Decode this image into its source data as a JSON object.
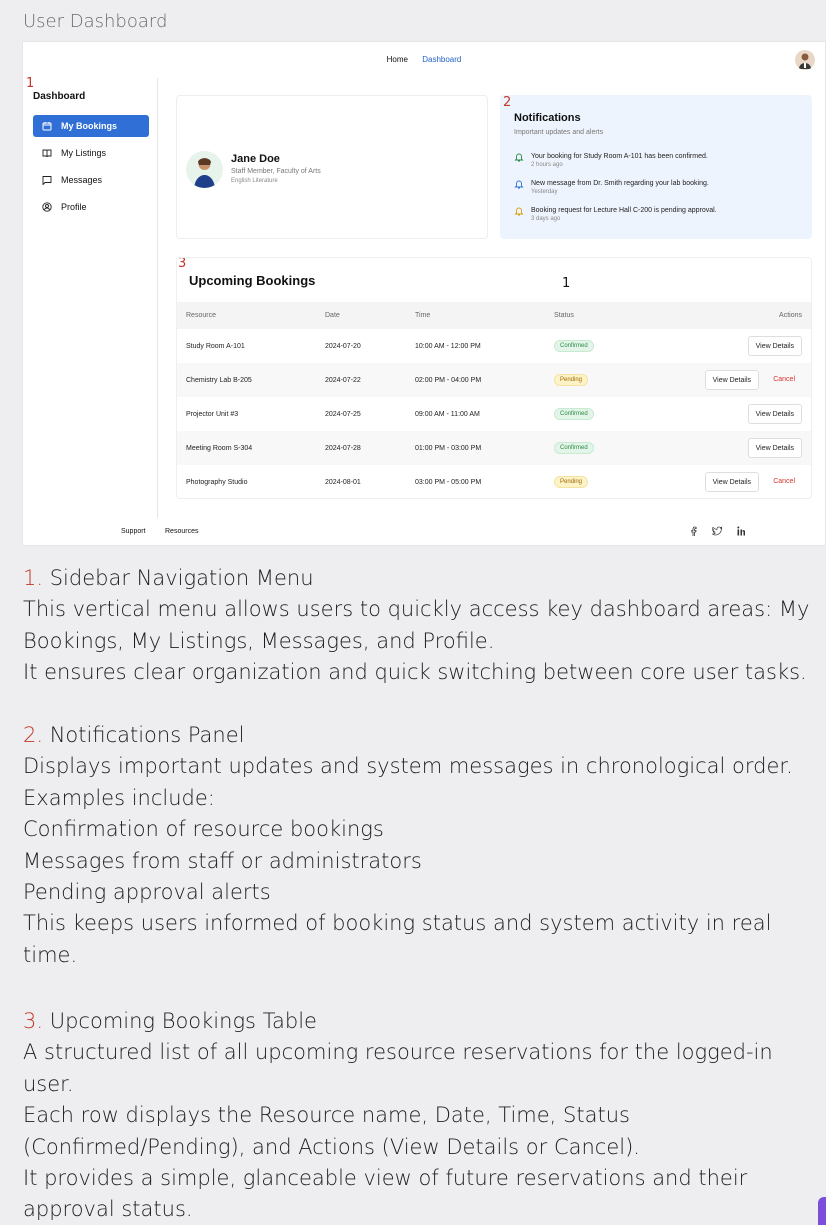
{
  "page": {
    "title": "User Dashboard"
  },
  "topnav": {
    "home": "Home",
    "dashboard": "Dashboard"
  },
  "markers": {
    "m1": "1",
    "m2": "2",
    "m3": "3"
  },
  "sidebar": {
    "title": "Dashboard",
    "items": [
      {
        "label": "My Bookings",
        "icon": "calendar-icon",
        "active": true
      },
      {
        "label": "My Listings",
        "icon": "book-icon",
        "active": false
      },
      {
        "label": "Messages",
        "icon": "message-icon",
        "active": false
      },
      {
        "label": "Profile",
        "icon": "user-circle-icon",
        "active": false
      }
    ]
  },
  "profile": {
    "name": "Jane Doe",
    "role": "Staff Member, Faculty of Arts",
    "department": "English Literature"
  },
  "notifications": {
    "title": "Notifications",
    "subtitle": "Important updates and alerts",
    "items": [
      {
        "text": "Your booking for Study Room A-101 has been confirmed.",
        "time": "2 hours ago",
        "color": "#2a8a45"
      },
      {
        "text": "New message from Dr. Smith regarding your lab booking.",
        "time": "Yesterday",
        "color": "#2f6fd6"
      },
      {
        "text": "Booking request for Lecture Hall C-200 is pending approval.",
        "time": "3 days ago",
        "color": "#d69e0b"
      }
    ]
  },
  "bookings": {
    "title": "Upcoming Bookings",
    "count": "1",
    "columns": [
      "Resource",
      "Date",
      "Time",
      "Status",
      "Actions"
    ],
    "rows": [
      {
        "resource": "Study Room A-101",
        "date": "2024-07-20",
        "time": "10:00 AM - 12:00 PM",
        "status": "Confirmed",
        "view": "View Details",
        "cancel": ""
      },
      {
        "resource": "Chemistry Lab B-205",
        "date": "2024-07-22",
        "time": "02:00 PM - 04:00 PM",
        "status": "Pending",
        "view": "View Details",
        "cancel": "Cancel"
      },
      {
        "resource": "Projector Unit #3",
        "date": "2024-07-25",
        "time": "09:00 AM - 11:00 AM",
        "status": "Confirmed",
        "view": "View Details",
        "cancel": ""
      },
      {
        "resource": "Meeting Room S-304",
        "date": "2024-07-28",
        "time": "01:00 PM - 03:00 PM",
        "status": "Confirmed",
        "view": "View Details",
        "cancel": ""
      },
      {
        "resource": "Photography Studio",
        "date": "2024-08-01",
        "time": "03:00 PM - 05:00 PM",
        "status": "Pending",
        "view": "View Details",
        "cancel": "Cancel"
      }
    ]
  },
  "footer": {
    "support": "Support",
    "resources": "Resources",
    "social": [
      "facebook-icon",
      "twitter-icon",
      "linkedin-icon"
    ]
  },
  "description": {
    "s1": {
      "num": "1.",
      "title": " Sidebar Navigation Menu",
      "lines": [
        "This vertical menu allows users to quickly access key dashboard areas: My Bookings, My Listings, Messages, and Profile.",
        "It ensures clear organization and quick switching between core user tasks."
      ]
    },
    "s2": {
      "num": "2.",
      "title": " Notifications Panel",
      "lines": [
        "Displays important updates and system messages in chronological order.",
        "Examples include:",
        "Confirmation of resource bookings",
        "Messages from staff or administrators",
        "Pending approval alerts",
        "This keeps users informed of booking status and system activity in real time."
      ]
    },
    "s3": {
      "num": "3.",
      "title": " Upcoming Bookings Table",
      "lines": [
        "A structured list of all upcoming resource reservations for the logged-in user.",
        "Each row displays the Resource name, Date, Time, Status (Confirmed/Pending), and Actions (View Details or Cancel).",
        "It provides a simple, glanceable view of future reservations and their approval status."
      ]
    }
  }
}
